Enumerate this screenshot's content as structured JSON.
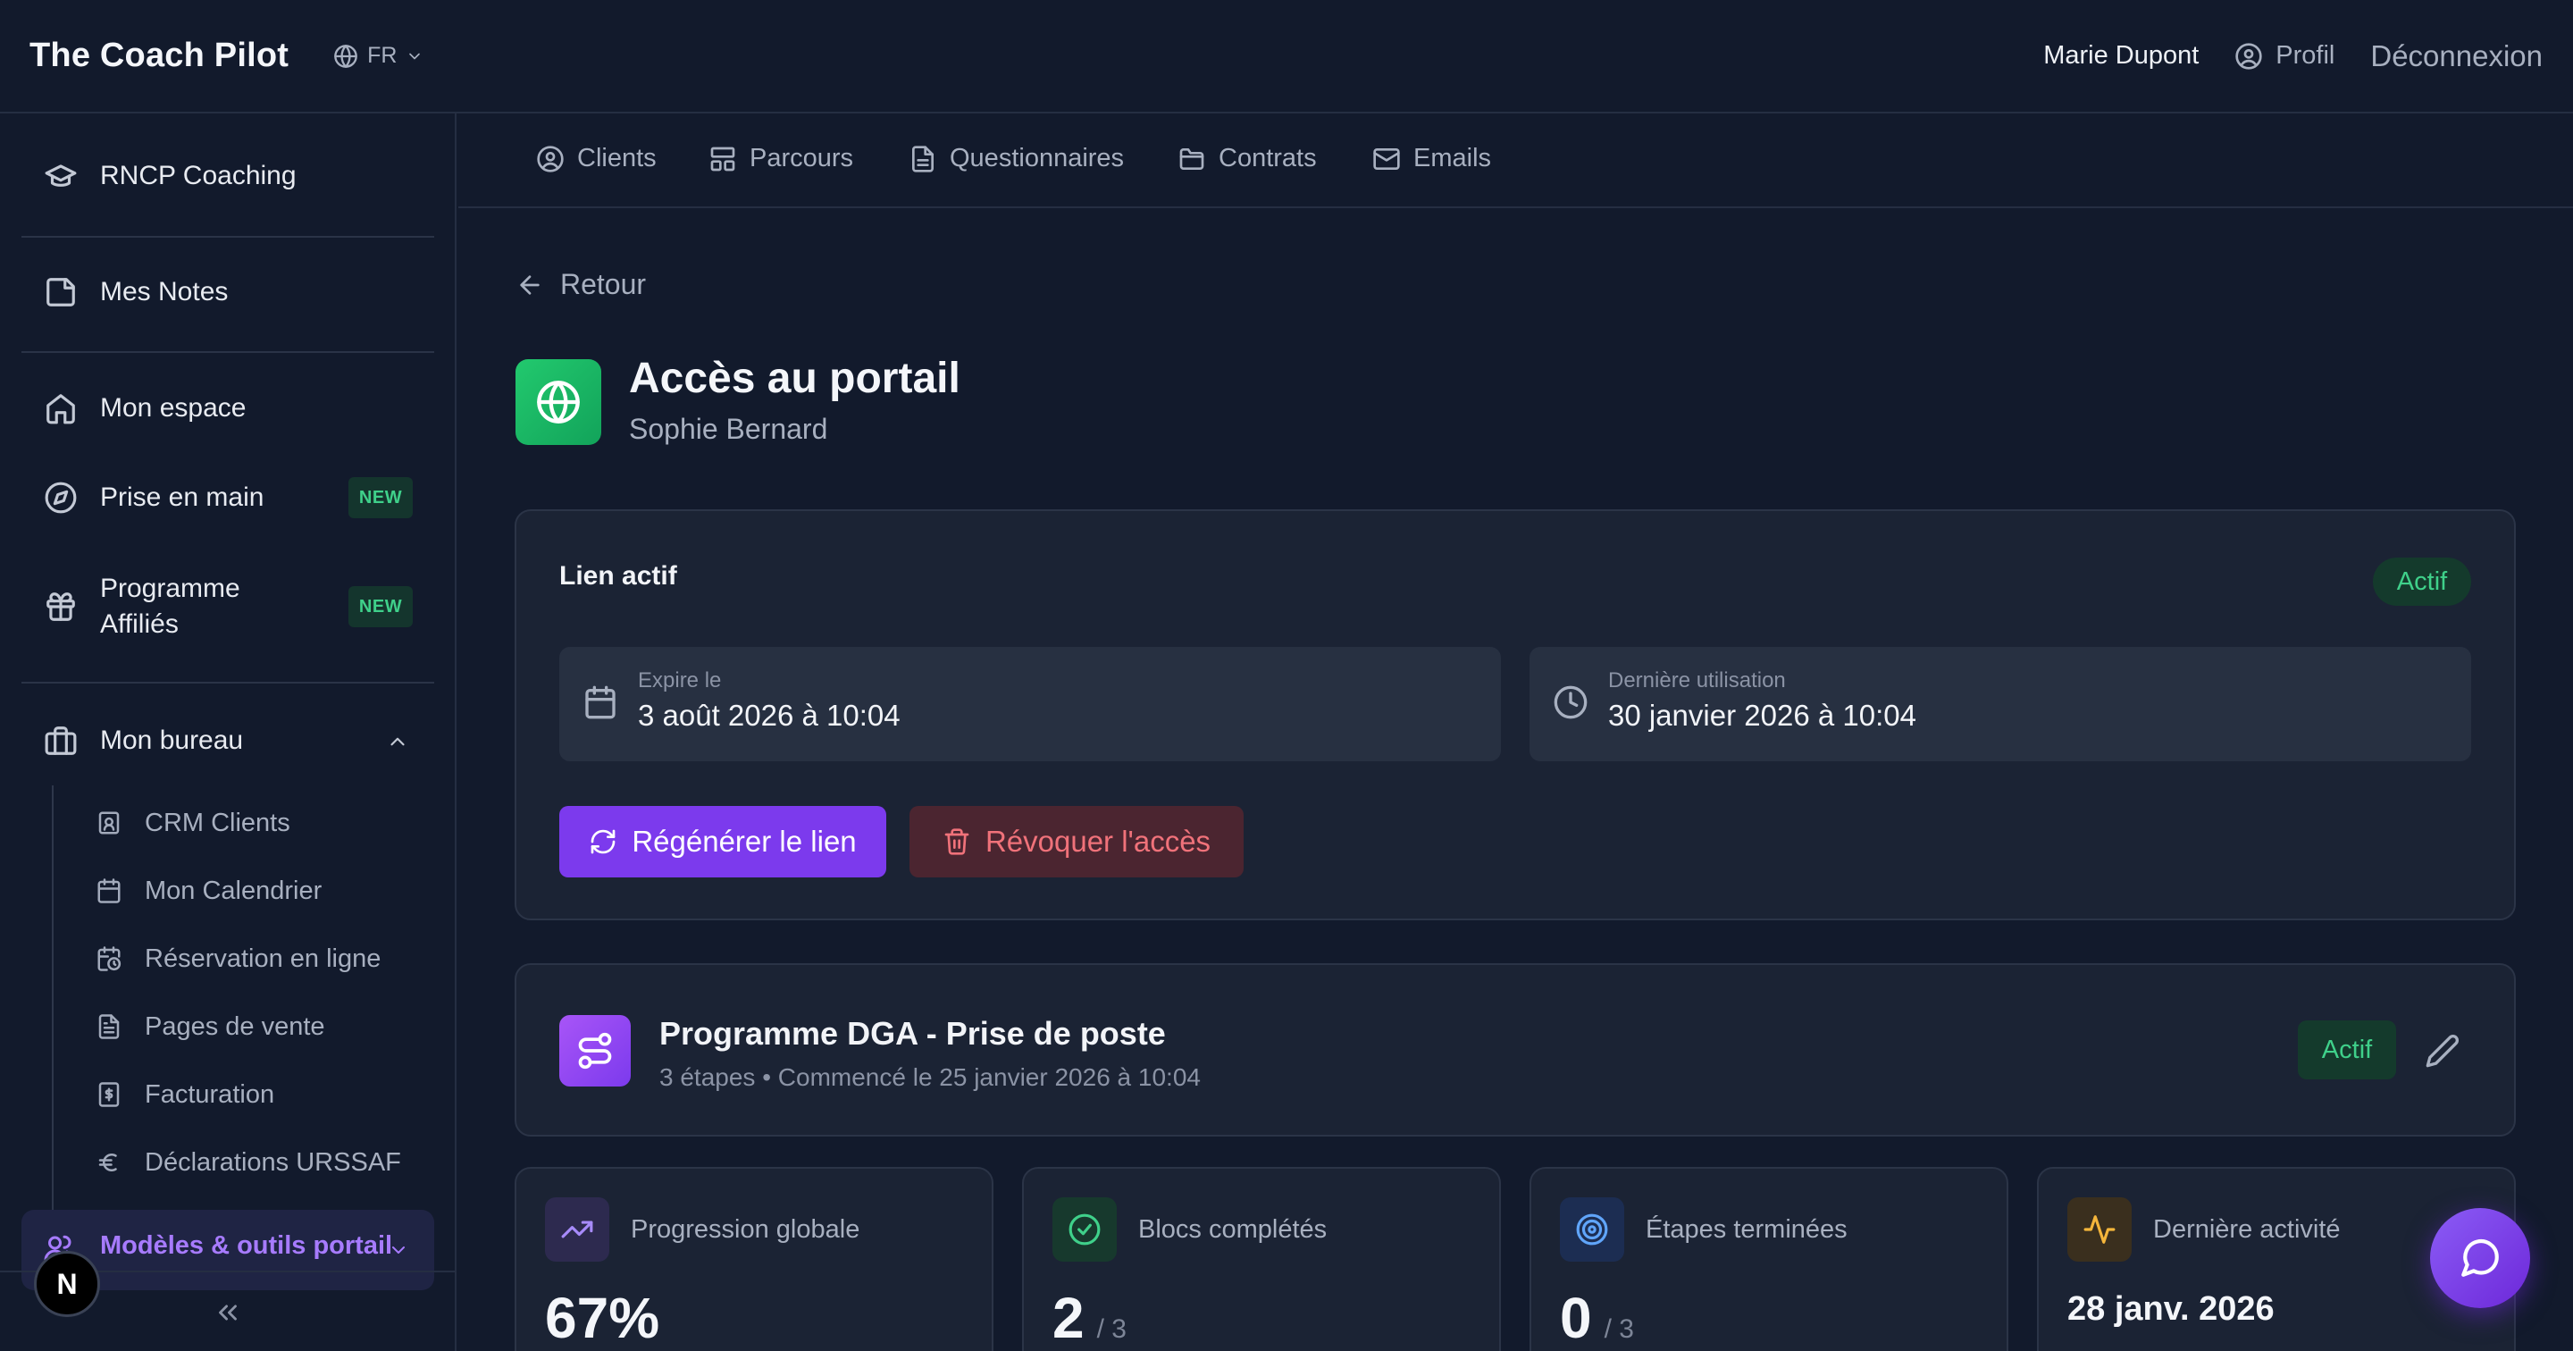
{
  "header": {
    "brand": "The Coach Pilot",
    "language": "FR",
    "user_name": "Marie Dupont",
    "profile_label": "Profil",
    "logout_label": "Déconnexion"
  },
  "sidebar": {
    "items": [
      {
        "label": "RNCP Coaching",
        "icon": "graduation-cap-icon"
      },
      {
        "label": "Mes Notes",
        "icon": "note-icon"
      },
      {
        "label": "Mon espace",
        "icon": "home-icon"
      },
      {
        "label": "Prise en main",
        "icon": "compass-icon",
        "badge": "NEW"
      },
      {
        "label": "Programme Affiliés",
        "label_line1": "Programme",
        "label_line2": "Affiliés",
        "icon": "gift-icon",
        "badge": "NEW"
      }
    ],
    "section": {
      "label": "Mon bureau",
      "icon": "briefcase-icon",
      "expanded": true
    },
    "sub_items": [
      {
        "label": "CRM Clients",
        "icon": "contact-icon"
      },
      {
        "label": "Mon Calendrier",
        "icon": "calendar-icon"
      },
      {
        "label": "Réservation en ligne",
        "icon": "calendar-clock-icon"
      },
      {
        "label": "Pages de vente",
        "icon": "file-text-icon"
      },
      {
        "label": "Facturation",
        "icon": "dollar-file-icon"
      },
      {
        "label": "Déclarations URSSAF",
        "icon": "euro-icon"
      }
    ],
    "active_item": {
      "label": "Modèles & outils portail",
      "icon": "users-icon"
    },
    "avatar_letter": "N"
  },
  "tabs": [
    {
      "label": "Clients",
      "icon": "user-circle-icon"
    },
    {
      "label": "Parcours",
      "icon": "layout-icon"
    },
    {
      "label": "Questionnaires",
      "icon": "file-icon"
    },
    {
      "label": "Contrats",
      "icon": "folder-icon"
    },
    {
      "label": "Emails",
      "icon": "mail-icon"
    }
  ],
  "page": {
    "back_label": "Retour",
    "title": "Accès au portail",
    "subtitle": "Sophie Bernard"
  },
  "link_card": {
    "title": "Lien actif",
    "status": "Actif",
    "expires_label": "Expire le",
    "expires_value": "3 août 2026 à 10:04",
    "last_used_label": "Dernière utilisation",
    "last_used_value": "30 janvier 2026 à 10:04",
    "regenerate_label": "Régénérer le lien",
    "revoke_label": "Révoquer l'accès"
  },
  "program_card": {
    "title": "Programme DGA - Prise de poste",
    "meta": "3 étapes • Commencé le 25 janvier 2026 à 10:04",
    "status": "Actif"
  },
  "stats": [
    {
      "label": "Progression globale",
      "value": "67%",
      "icon": "trending-up-icon",
      "accent": "#8b5cf6"
    },
    {
      "label": "Blocs complétés",
      "value": "2",
      "denominator": "/ 3",
      "icon": "check-circle-icon",
      "accent": "#22c55e"
    },
    {
      "label": "Étapes terminées",
      "value": "0",
      "denominator": "/ 3",
      "icon": "target-icon",
      "accent": "#3b82f6"
    },
    {
      "label": "Dernière activité",
      "value": "28 janv. 2026",
      "icon": "activity-icon",
      "accent": "#f59e0b"
    }
  ],
  "colors": {
    "background": "#121a2c",
    "accent": "#7c3aed",
    "success": "#3fd08a",
    "danger": "#f0727a"
  }
}
